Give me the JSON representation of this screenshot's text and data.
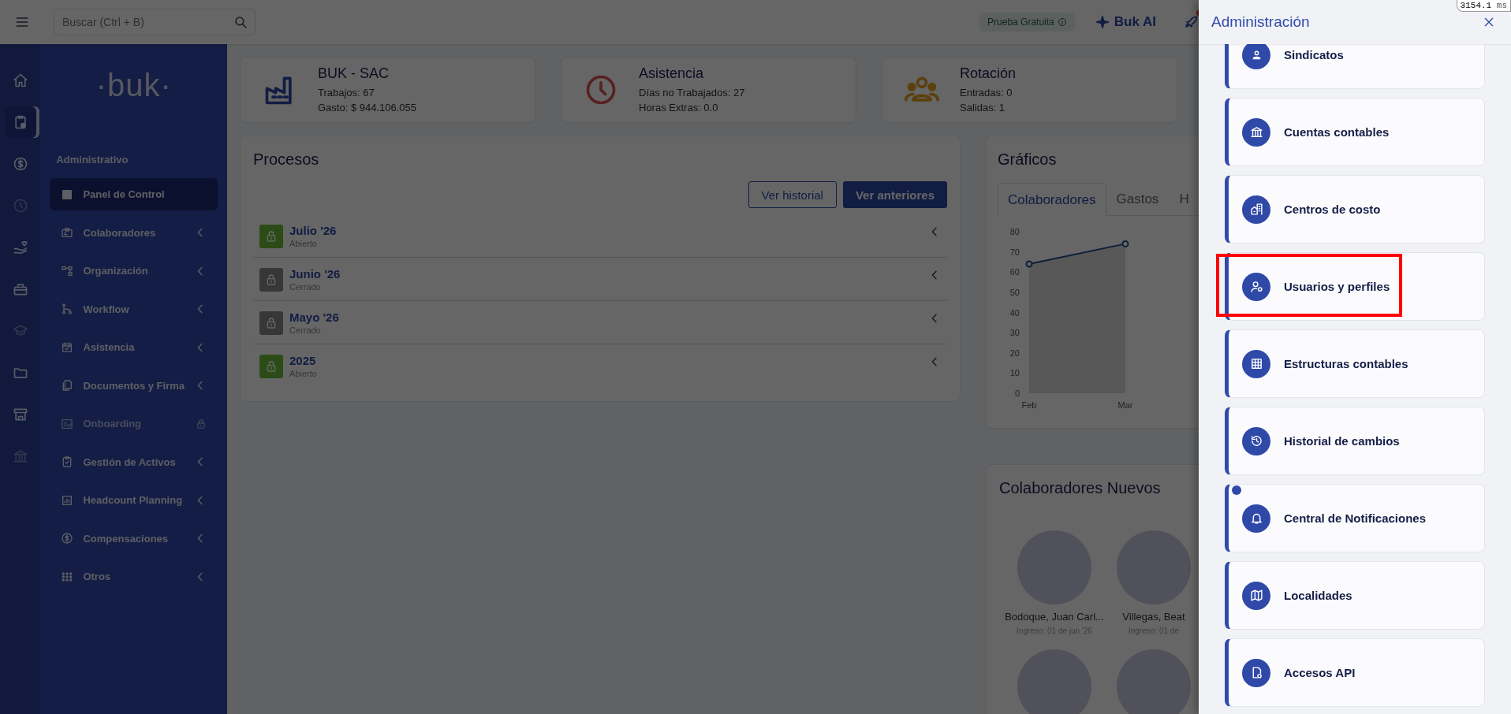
{
  "topbar": {
    "search": {
      "placeholder": "Buscar (Ctrl + B)"
    },
    "trial_badge": "Prueba Gratuita",
    "ai_button": "Buk AI",
    "rocket_badge": true
  },
  "perf_overlay": {
    "value": "3154.1",
    "unit": "ms"
  },
  "rail": [
    {
      "selected": false,
      "disabled": false
    },
    {
      "selected": true,
      "disabled": false
    },
    {
      "selected": false,
      "disabled": false
    },
    {
      "selected": false,
      "disabled": true
    },
    {
      "selected": false,
      "disabled": false
    },
    {
      "selected": false,
      "disabled": false
    },
    {
      "selected": false,
      "disabled": true
    },
    {
      "selected": false,
      "disabled": false
    },
    {
      "selected": false,
      "disabled": false
    },
    {
      "selected": false,
      "disabled": true
    }
  ],
  "sidebar": {
    "logo": "·buk·",
    "section": "Administrativo",
    "items": [
      {
        "label": "Panel de Control",
        "selected": true,
        "disabled": false,
        "expandable": false
      },
      {
        "label": "Colaboradores",
        "selected": false,
        "disabled": false,
        "expandable": true
      },
      {
        "label": "Organización",
        "selected": false,
        "disabled": false,
        "expandable": true
      },
      {
        "label": "Workflow",
        "selected": false,
        "disabled": false,
        "expandable": true
      },
      {
        "label": "Asistencia",
        "selected": false,
        "disabled": false,
        "expandable": true
      },
      {
        "label": "Documentos y Firma",
        "selected": false,
        "disabled": false,
        "expandable": true
      },
      {
        "label": "Onboarding",
        "selected": false,
        "disabled": true,
        "expandable": false
      },
      {
        "label": "Gestión de Activos",
        "selected": false,
        "disabled": false,
        "expandable": true
      },
      {
        "label": "Headcount Planning",
        "selected": false,
        "disabled": false,
        "expandable": true
      },
      {
        "label": "Compensaciones",
        "selected": false,
        "disabled": false,
        "expandable": true
      },
      {
        "label": "Otros",
        "selected": false,
        "disabled": false,
        "expandable": true
      }
    ]
  },
  "summary_cards": [
    {
      "title": "BUK - SAC",
      "lines": [
        "Trabajos: 67",
        "Gasto: $ 944.106.055"
      ]
    },
    {
      "title": "Asistencia",
      "lines": [
        "Días no Trabajados: 27",
        "Horas Extras: 0.0"
      ]
    },
    {
      "title": "Rotación",
      "lines": [
        "Entradas: 0",
        "Salidas: 1"
      ]
    }
  ],
  "processes": {
    "title": "Procesos",
    "buttons": [
      {
        "label": "Ver historial",
        "kind": "outline"
      },
      {
        "label": "Ver anteriores",
        "kind": "primary"
      }
    ],
    "rows": [
      {
        "name": "Julio '26",
        "status": "Abierto",
        "open": true
      },
      {
        "name": "Junio '26",
        "status": "Cerrado",
        "open": false
      },
      {
        "name": "Mayo '26",
        "status": "Cerrado",
        "open": false
      },
      {
        "name": "2025",
        "status": "Abierto",
        "open": true
      }
    ]
  },
  "charts": {
    "title": "Gráficos",
    "tabs": [
      {
        "label": "Colaboradores",
        "selected": true
      },
      {
        "label": "Gastos",
        "selected": false
      },
      {
        "label": "H",
        "selected": false
      }
    ],
    "chart_data": {
      "type": "area",
      "categories": [
        "Feb",
        "Mar"
      ],
      "values": [
        64,
        74
      ],
      "ylim": [
        0,
        80
      ],
      "yticks": [
        0,
        10,
        20,
        30,
        40,
        50,
        60,
        70,
        80
      ]
    }
  },
  "new_employees": {
    "title": "Colaboradores Nuevos",
    "people": [
      {
        "kind": "full",
        "name": "Bodoque, Juan Carl...",
        "joined": "Ingreso: 01 de jun '26"
      },
      {
        "kind": "full",
        "name": "Villegas, Beat",
        "joined": "Ingreso: 01 de"
      },
      {
        "kind": "cut"
      },
      {
        "kind": "cut"
      }
    ]
  },
  "admin_panel": {
    "title": "Administración",
    "items": [
      {
        "label": "Sindicatos",
        "highlighted": false,
        "badge": false
      },
      {
        "label": "Cuentas contables",
        "highlighted": false,
        "badge": false
      },
      {
        "label": "Centros de costo",
        "highlighted": false,
        "badge": false
      },
      {
        "label": "Usuarios y perfiles",
        "highlighted": true,
        "badge": false
      },
      {
        "label": "Estructuras contables",
        "highlighted": false,
        "badge": false
      },
      {
        "label": "Historial de cambios",
        "highlighted": false,
        "badge": false
      },
      {
        "label": "Central de Notificaciones",
        "highlighted": false,
        "badge": true
      },
      {
        "label": "Localidades",
        "highlighted": false,
        "badge": false
      },
      {
        "label": "Accesos API",
        "highlighted": false,
        "badge": false
      }
    ]
  }
}
